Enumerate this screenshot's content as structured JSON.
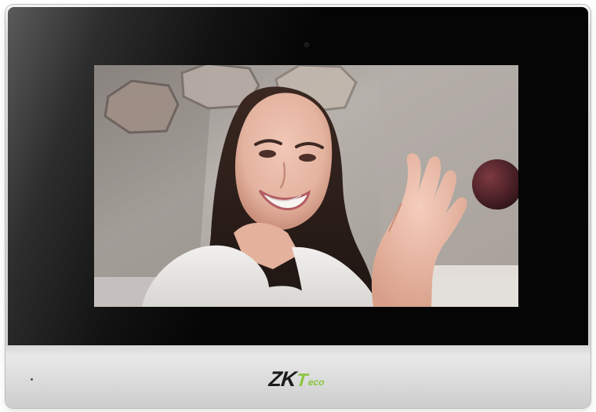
{
  "device": {
    "brand_parts": {
      "primary": "ZK",
      "secondary_initial": "T",
      "secondary_rest": "eco"
    }
  },
  "icons": {
    "camera": "camera-icon",
    "microphone": "microphone-icon"
  },
  "colors": {
    "frame_black": "#050505",
    "bezel_silver": "#d6d6d6",
    "brand_dark": "#1b1b1b",
    "brand_green": "#8bc540"
  }
}
